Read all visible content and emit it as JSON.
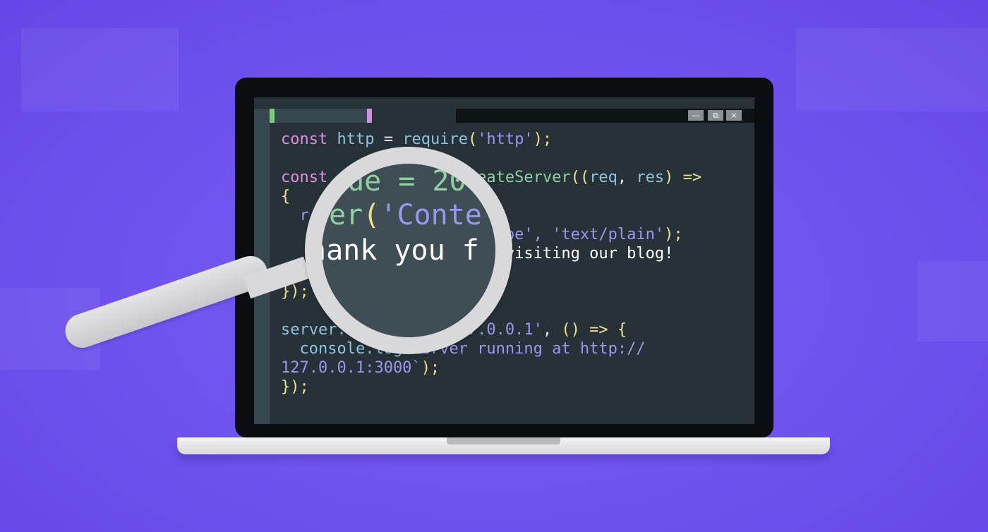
{
  "window": {
    "minimize_icon": "—",
    "restore_icon": "⧉",
    "close_icon": "×"
  },
  "code_lines": [
    [
      {
        "t": "const ",
        "c": "kw"
      },
      {
        "t": "http ",
        "c": "fn"
      },
      {
        "t": "= ",
        "c": "pl"
      },
      {
        "t": "require",
        "c": "fn"
      },
      {
        "t": "(",
        "c": "pu"
      },
      {
        "t": "'http'",
        "c": "st"
      },
      {
        "t": ");",
        "c": "pu"
      }
    ],
    [],
    [
      {
        "t": "const ",
        "c": "kw"
      },
      {
        "t": "         ",
        "c": "pl"
      },
      {
        "t": "    ",
        "c": "pl"
      },
      {
        "t": "createServer",
        "c": "gr"
      },
      {
        "t": "((",
        "c": "pu"
      },
      {
        "t": "req",
        "c": "fn"
      },
      {
        "t": ", ",
        "c": "pl"
      },
      {
        "t": "res",
        "c": "fn"
      },
      {
        "t": ") =>",
        "c": "pu"
      }
    ],
    [
      {
        "t": "{",
        "c": "pu"
      }
    ],
    [
      {
        "t": "  r",
        "c": "st"
      }
    ],
    [
      {
        "t": "                    ",
        "c": "pl"
      },
      {
        "t": "t-Type', ",
        "c": "st"
      },
      {
        "t": "'text/plain'",
        "c": "st"
      },
      {
        "t": ");",
        "c": "pu"
      }
    ],
    [
      {
        "t": "                      ",
        "c": "pl"
      },
      {
        "t": "r visiting our blog!",
        "c": "wh"
      }
    ],
    [
      {
        "t": "\\n",
        "c": "wh"
      }
    ],
    [
      {
        "t": "});",
        "c": "pu"
      }
    ],
    [],
    [
      {
        "t": "server.",
        "c": "fn"
      },
      {
        "t": "          ",
        "c": "pl"
      },
      {
        "t": "'127.0.0.1'",
        "c": "st"
      },
      {
        "t": ", ",
        "c": "pl"
      },
      {
        "t": "() => {",
        "c": "pu"
      }
    ],
    [
      {
        "t": "  console.",
        "c": "fn"
      },
      {
        "t": "log",
        "c": "fn"
      },
      {
        "t": "`Server running at http://",
        "c": "st"
      }
    ],
    [
      {
        "t": "127.0.0.1:3000`",
        "c": "st"
      },
      {
        "t": ");",
        "c": "pu"
      }
    ],
    [
      {
        "t": "});",
        "c": "pu"
      }
    ]
  ],
  "lens_lines": [
    [
      {
        "t": "ue = 20",
        "c": "gr"
      }
    ],
    [
      {
        "t": "r",
        "c": "gr"
      },
      {
        "t": "er",
        "c": "gr"
      },
      {
        "t": "(",
        "c": "pu"
      },
      {
        "t": "'Conte",
        "c": "st"
      }
    ],
    [
      {
        "t": "hank you f",
        "c": "wh"
      }
    ]
  ],
  "colors": {
    "background": "#6f52ee",
    "editor_bg": "#263238",
    "keyword": "#e08ddc",
    "identifier": "#8ec3dd",
    "string": "#9b97f0",
    "punctuation": "#f0e08a",
    "function": "#8fd0a0"
  }
}
